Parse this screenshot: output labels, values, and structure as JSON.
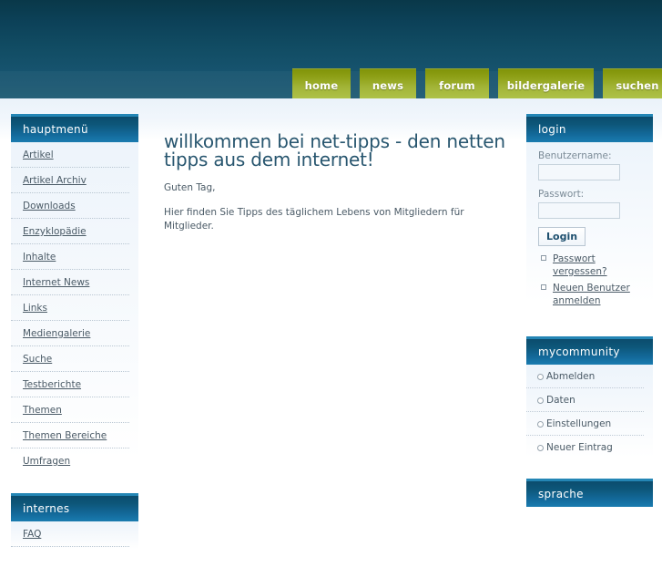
{
  "theme": {
    "header_top": "#093849",
    "header_bottom": "#205c75",
    "accent_green": "#aec248",
    "panel_blue": "#0d5679",
    "panel_blue_light": "#1a7cb0",
    "link_color": "#4a5a66"
  },
  "nav": {
    "items": [
      {
        "label": "home"
      },
      {
        "label": "news"
      },
      {
        "label": "forum"
      },
      {
        "label": "bildergalerie"
      },
      {
        "label": "suchen"
      }
    ]
  },
  "sidebar_left": {
    "panels": [
      {
        "title": "hauptmenü",
        "items": [
          {
            "label": "Artikel"
          },
          {
            "label": "Artikel Archiv"
          },
          {
            "label": "Downloads"
          },
          {
            "label": "Enzyklopädie"
          },
          {
            "label": "Inhalte"
          },
          {
            "label": "Internet News"
          },
          {
            "label": "Links"
          },
          {
            "label": "Mediengalerie"
          },
          {
            "label": "Suche"
          },
          {
            "label": "Testberichte"
          },
          {
            "label": "Themen"
          },
          {
            "label": "Themen Bereiche"
          },
          {
            "label": "Umfragen"
          }
        ]
      },
      {
        "title": "internes",
        "items": [
          {
            "label": "FAQ"
          }
        ]
      }
    ]
  },
  "content": {
    "title": "willkommen bei net-tipps - den netten tipps aus dem internet!",
    "paragraphs": [
      "Guten Tag,",
      "Hier finden Sie Tipps des täglichem Lebens von Mitgliedern für Mitglieder."
    ]
  },
  "sidebar_right": {
    "login": {
      "title": "login",
      "username_label": "Benutzername:",
      "username_value": "",
      "username_placeholder": "",
      "password_label": "Passwort:",
      "password_value": "",
      "password_placeholder": "",
      "submit_label": "Login",
      "links": [
        {
          "label": "Passwort vergessen?"
        },
        {
          "label": "Neuen Benutzer anmelden"
        }
      ]
    },
    "mycommunity": {
      "title": "mycommunity",
      "items": [
        {
          "label": "Abmelden"
        },
        {
          "label": "Daten"
        },
        {
          "label": "Einstellungen"
        },
        {
          "label": "Neuer Eintrag"
        }
      ]
    },
    "sprache": {
      "title": "sprache"
    }
  }
}
